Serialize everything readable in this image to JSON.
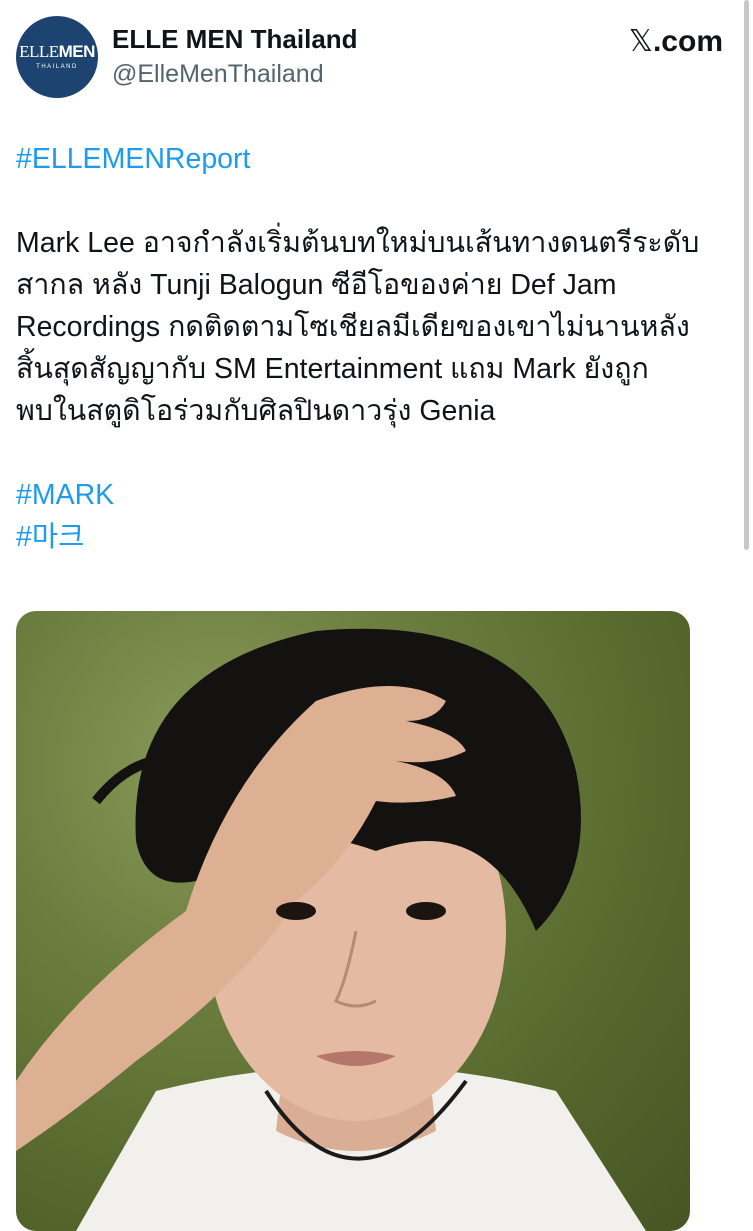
{
  "account": {
    "display_name": "ELLE MEN Thailand",
    "handle": "@ElleMenThailand",
    "avatar_logo_elle": "ELLE",
    "avatar_logo_men": "MEN",
    "avatar_logo_sub": "THAILAND"
  },
  "brand": {
    "x_glyph": "𝕏",
    "domain": ".com"
  },
  "tweet": {
    "tag_report": "#ELLEMENReport",
    "lines": [
      "Mark Lee อาจกำลังเริ่มต้นบทใหม่บนเส้นทางดนตรีระดับ",
      "สากล หลัง Tunji Balogun ซีอีโอของค่าย  Def Jam",
      "Recordings กดติดตามโซเชียลมีเดียของเขาไม่นานหลัง",
      "สิ้นสุดสัญญากับ SM Entertainment แถม Mark ยังถูก",
      "พบในสตูดิโอร่วมกับศิลปินดาวรุ่ง Genia"
    ],
    "tag_mark": "#MARK",
    "tag_korean": "#마크"
  },
  "media": {
    "icon": "photo-icon"
  },
  "colors": {
    "link": "#1d9bf0",
    "text": "#0f1419",
    "secondary": "#536471",
    "avatar_bg": "#1d4470"
  }
}
